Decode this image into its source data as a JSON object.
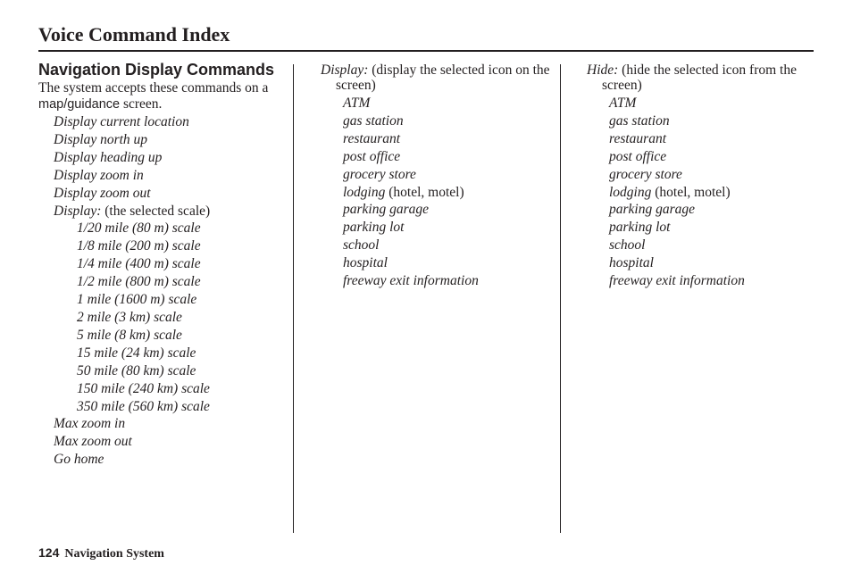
{
  "header": {
    "title": "Voice Command Index"
  },
  "column1": {
    "heading": "Navigation Display Commands",
    "intro_before": "The system accepts these commands on a ",
    "intro_term": "map/guidance",
    "intro_after": " screen.",
    "commands_top": [
      "Display current location",
      "Display north up",
      "Display heading up",
      "Display zoom in",
      "Display zoom out"
    ],
    "scale_group": {
      "command": "Display:",
      "note": " (the selected scale)",
      "items": [
        "1/20 mile (80 m) scale",
        "1/8 mile (200 m) scale",
        "1/4 mile (400 m) scale",
        "1/2 mile (800 m) scale",
        "1 mile (1600 m) scale",
        "2 mile (3 km) scale",
        "5 mile (8 km) scale",
        "15 mile (24 km) scale",
        "50 mile (80 km) scale",
        "150 mile (240 km) scale",
        "350 mile (560 km) scale"
      ]
    },
    "commands_bottom": [
      "Max zoom in",
      "Max zoom out",
      "Go home"
    ]
  },
  "column2": {
    "command": "Display:",
    "note": " (display the selected icon on the screen)",
    "items": [
      {
        "cmd": "ATM",
        "note": ""
      },
      {
        "cmd": "gas station",
        "note": ""
      },
      {
        "cmd": "restaurant",
        "note": ""
      },
      {
        "cmd": "post office",
        "note": ""
      },
      {
        "cmd": "grocery store",
        "note": ""
      },
      {
        "cmd": "lodging",
        "note": " (hotel, motel)"
      },
      {
        "cmd": "parking garage",
        "note": ""
      },
      {
        "cmd": "parking lot",
        "note": ""
      },
      {
        "cmd": "school",
        "note": ""
      },
      {
        "cmd": "hospital",
        "note": ""
      },
      {
        "cmd": "freeway exit information",
        "note": ""
      }
    ]
  },
  "column3": {
    "command": "Hide:",
    "note": " (hide the selected icon from the screen)",
    "items": [
      {
        "cmd": "ATM",
        "note": ""
      },
      {
        "cmd": "gas station",
        "note": ""
      },
      {
        "cmd": "restaurant",
        "note": ""
      },
      {
        "cmd": "post office",
        "note": ""
      },
      {
        "cmd": "grocery store",
        "note": ""
      },
      {
        "cmd": "lodging",
        "note": " (hotel, motel)"
      },
      {
        "cmd": "parking garage",
        "note": ""
      },
      {
        "cmd": "parking lot",
        "note": ""
      },
      {
        "cmd": "school",
        "note": ""
      },
      {
        "cmd": "hospital",
        "note": ""
      },
      {
        "cmd": "freeway exit information",
        "note": ""
      }
    ]
  },
  "footer": {
    "page_number": "124",
    "section": "Navigation System"
  }
}
